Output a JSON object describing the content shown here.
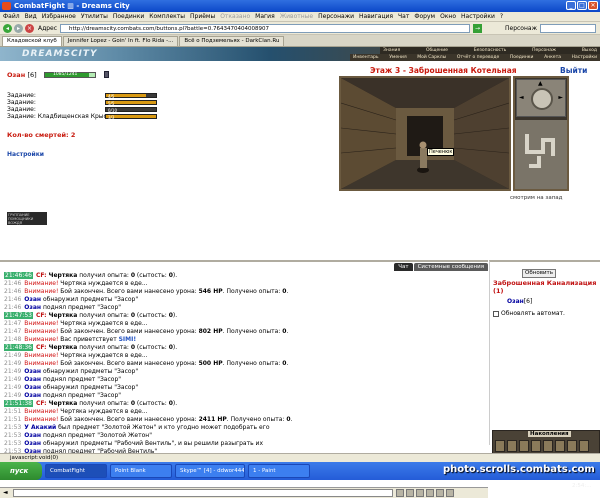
{
  "window": {
    "title": "CombatFight ▥ - Dreams City",
    "controls": [
      "_",
      "□",
      "✕"
    ]
  },
  "menu": [
    "Файл",
    "Вид",
    "Избранное",
    "Утилиты",
    "Поединки",
    "Комплекты",
    "Приёмы",
    "Отказано",
    "Магия",
    "Животные",
    "Персонажи",
    "Навигация",
    "Чат",
    "Форум",
    "Окно",
    "Настройки",
    "?"
  ],
  "address": {
    "label": "Адрес",
    "value": "http://dreamscity.combats.com/buttons.pl?battle=0.7643470404008907",
    "search_label": "Персонаж"
  },
  "tabs": [
    "Кладовской клуб",
    "Jennifer Lopez - Goin' In ft. Flo Rida -...",
    "Всё о Подземельях - DarkClan.Ru"
  ],
  "game": {
    "logo": "DREAMSCITY",
    "nav_top": [
      "Знания",
      "Общение",
      "Безопасность",
      "Персонаж",
      "Выход"
    ],
    "nav_bottom": [
      "Инвентарь",
      "Умения",
      "Мой Сарклы",
      "Отчёт о переводе",
      "Поединки",
      "Анкета",
      "Настройки"
    ],
    "character": {
      "name": "Озан",
      "level": "[6]",
      "hp_text": "1085/1241",
      "hp_fraction": 0.87
    },
    "tasks": [
      {
        "label": "Задание:",
        "progress": "4/5",
        "fraction": 0.8
      },
      {
        "label": "Задание:",
        "progress": "5/5",
        "fraction": 1.0
      },
      {
        "label": "Задание:",
        "progress": "0/10",
        "fraction": 0.0
      },
      {
        "label": "Задание: Кладбищенская Крыса",
        "progress": "3/3",
        "fraction": 1.0
      }
    ],
    "deaths": "Кол-во смертей: 2",
    "settings": "Настройки",
    "badge": "ГРУППАНИЕ ПОМОЩНИКИ ВОЖДЯ",
    "location": "Этаж 3 - Заброшенная Котельная",
    "exit": "Выйти",
    "scene_label": "Печенюк",
    "view_dir": "смотрим на запад"
  },
  "log": {
    "tabs": [
      "Чат",
      "Системные сообщения"
    ],
    "lines": [
      {
        "time": "21:46:46",
        "green": true,
        "parts": [
          {
            "c": "cf",
            "t": "CF:"
          },
          {
            "c": "b",
            "t": " Чертяка"
          },
          {
            "c": "",
            "t": " получил опыта: "
          },
          {
            "c": "b",
            "t": "0"
          },
          {
            "c": "",
            "t": " (сытость: "
          },
          {
            "c": "b",
            "t": "0"
          },
          {
            "c": "",
            "t": ")."
          }
        ]
      },
      {
        "time": "21:46",
        "green": false,
        "parts": [
          {
            "c": "w",
            "t": "Внимание!"
          },
          {
            "c": "",
            "t": " Чертяка нуждается в еде..."
          }
        ]
      },
      {
        "time": "21:46",
        "green": false,
        "parts": [
          {
            "c": "w",
            "t": "Внимание!"
          },
          {
            "c": "",
            "t": " Бой закончен. Всего вами нанесено урона: "
          },
          {
            "c": "b",
            "t": "546 HP"
          },
          {
            "c": "",
            "t": ". Получено опыта: "
          },
          {
            "c": "b",
            "t": "0"
          },
          {
            "c": "",
            "t": "."
          }
        ]
      },
      {
        "time": "21:46",
        "green": false,
        "parts": [
          {
            "c": "n",
            "t": "Озан"
          },
          {
            "c": "",
            "t": " обнаружил предметы \"Засор\""
          }
        ]
      },
      {
        "time": "21:46",
        "green": false,
        "parts": [
          {
            "c": "n",
            "t": "Озан"
          },
          {
            "c": "",
            "t": " поднял предмет \"Засор\""
          }
        ]
      },
      {
        "time": "21:47:53",
        "green": true,
        "parts": [
          {
            "c": "cf",
            "t": "CF:"
          },
          {
            "c": "b",
            "t": " Чертяка"
          },
          {
            "c": "",
            "t": " получил опыта: "
          },
          {
            "c": "b",
            "t": "0"
          },
          {
            "c": "",
            "t": " (сытость: "
          },
          {
            "c": "b",
            "t": "0"
          },
          {
            "c": "",
            "t": ")."
          }
        ]
      },
      {
        "time": "21:47",
        "green": false,
        "parts": [
          {
            "c": "w",
            "t": "Внимание!"
          },
          {
            "c": "",
            "t": " Чертяка нуждается в еде..."
          }
        ]
      },
      {
        "time": "21:47",
        "green": false,
        "parts": [
          {
            "c": "w",
            "t": "Внимание!"
          },
          {
            "c": "",
            "t": " Бой закончен. Всего вами нанесено урона: "
          },
          {
            "c": "b",
            "t": "802 HP"
          },
          {
            "c": "",
            "t": ". Получено опыта: "
          },
          {
            "c": "b",
            "t": "0"
          },
          {
            "c": "",
            "t": "."
          }
        ]
      },
      {
        "time": "21:48",
        "green": false,
        "parts": [
          {
            "c": "w",
            "t": "Внимание!"
          },
          {
            "c": "",
            "t": " Вас приветствует "
          },
          {
            "c": "blue",
            "t": "SIMI!"
          }
        ]
      },
      {
        "time": "21:48:36",
        "green": true,
        "parts": [
          {
            "c": "cf",
            "t": "CF:"
          },
          {
            "c": "b",
            "t": " Чертяка"
          },
          {
            "c": "",
            "t": " получил опыта: "
          },
          {
            "c": "b",
            "t": "0"
          },
          {
            "c": "",
            "t": " (сытость: "
          },
          {
            "c": "b",
            "t": "0"
          },
          {
            "c": "",
            "t": ")."
          }
        ]
      },
      {
        "time": "21:49",
        "green": false,
        "parts": [
          {
            "c": "w",
            "t": "Внимание!"
          },
          {
            "c": "",
            "t": " Чертяка нуждается в еде..."
          }
        ]
      },
      {
        "time": "21:49",
        "green": false,
        "parts": [
          {
            "c": "w",
            "t": "Внимание!"
          },
          {
            "c": "",
            "t": " Бой закончен. Всего вами нанесено урона: "
          },
          {
            "c": "b",
            "t": "500 HP"
          },
          {
            "c": "",
            "t": ". Получено опыта: "
          },
          {
            "c": "b",
            "t": "0"
          },
          {
            "c": "",
            "t": "."
          }
        ]
      },
      {
        "time": "21:49",
        "green": false,
        "parts": [
          {
            "c": "n",
            "t": "Озан"
          },
          {
            "c": "",
            "t": " обнаружил предметы \"Засор\""
          }
        ]
      },
      {
        "time": "21:49",
        "green": false,
        "parts": [
          {
            "c": "n",
            "t": "Озан"
          },
          {
            "c": "",
            "t": " поднял предмет \"Засор\""
          }
        ]
      },
      {
        "time": "21:49",
        "green": false,
        "parts": [
          {
            "c": "n",
            "t": "Озан"
          },
          {
            "c": "",
            "t": " обнаружил предметы \"Засор\""
          }
        ]
      },
      {
        "time": "21:49",
        "green": false,
        "parts": [
          {
            "c": "n",
            "t": "Озан"
          },
          {
            "c": "",
            "t": " поднял предмет \"Засор\""
          }
        ]
      },
      {
        "time": "21:51:38",
        "green": true,
        "parts": [
          {
            "c": "cf",
            "t": "CF:"
          },
          {
            "c": "b",
            "t": " Чертяка"
          },
          {
            "c": "",
            "t": " получил опыта: "
          },
          {
            "c": "b",
            "t": "0"
          },
          {
            "c": "",
            "t": " (сытость: "
          },
          {
            "c": "b",
            "t": "0"
          },
          {
            "c": "",
            "t": ")."
          }
        ]
      },
      {
        "time": "21:51",
        "green": false,
        "parts": [
          {
            "c": "w",
            "t": "Внимание!"
          },
          {
            "c": "",
            "t": " Чертяка нуждается в еде..."
          }
        ]
      },
      {
        "time": "21:51",
        "green": false,
        "parts": [
          {
            "c": "w",
            "t": "Внимание!"
          },
          {
            "c": "",
            "t": " Бой закончен. Всего вами нанесено урона: "
          },
          {
            "c": "b",
            "t": "2411 HP"
          },
          {
            "c": "",
            "t": ". Получено опыта: "
          },
          {
            "c": "b",
            "t": "0"
          },
          {
            "c": "",
            "t": "."
          }
        ]
      },
      {
        "time": "21:53",
        "green": false,
        "parts": [
          {
            "c": "n",
            "t": "У Акакий"
          },
          {
            "c": "",
            "t": " был предмет \"Золотой Жетон\" и кто угодно может подобрать его"
          }
        ]
      },
      {
        "time": "21:53",
        "green": false,
        "parts": [
          {
            "c": "n",
            "t": "Озан"
          },
          {
            "c": "",
            "t": " поднял предмет \"Золотой Жетон\""
          }
        ]
      },
      {
        "time": "21:53",
        "green": false,
        "parts": [
          {
            "c": "n",
            "t": "Озан"
          },
          {
            "c": "",
            "t": " обнаружил предметы \"Рабочий Вентиль\", и вы решили разыграть их"
          }
        ]
      },
      {
        "time": "21:53",
        "green": false,
        "parts": [
          {
            "c": "n",
            "t": "Озан"
          },
          {
            "c": "",
            "t": " поднял предмет \"Рабочий Вентиль\""
          }
        ]
      }
    ]
  },
  "side": {
    "refresh": "Обновить",
    "room": "Заброшенная Канализация (1)",
    "member": "Озан",
    "member_level": "[6]",
    "auto": "Обновлять автомат.",
    "accum": "Накопления",
    "clock": "2:54:..."
  },
  "statusbar": "javascript:void(0)",
  "taskbar": {
    "start": "пуск",
    "items": [
      "CombatFight",
      "Point Blank",
      "Skype™ [4] - ddwor444",
      "1 - Paint"
    ]
  },
  "watermark": "photo.scrolls.combats.com",
  "colors": {
    "alert": "#d01010",
    "nick": "#0000a0",
    "time_green": "#3ab06e",
    "xp_bar": "#d99a14"
  }
}
